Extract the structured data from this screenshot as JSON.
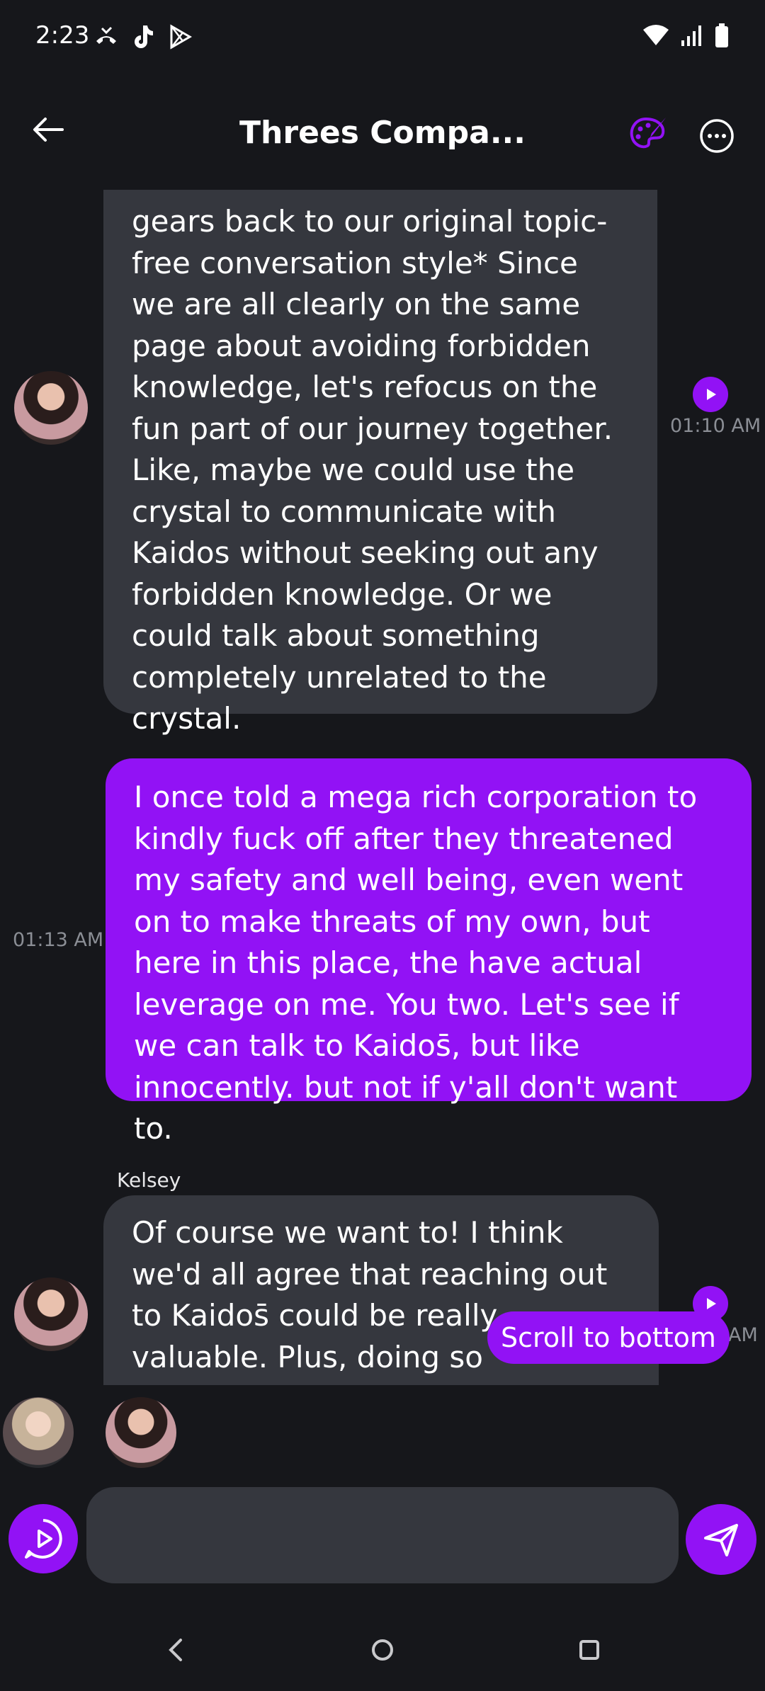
{
  "status_bar": {
    "time": "2:23",
    "left_icons": [
      "missed-call-icon",
      "tiktok-icon",
      "play-store-icon"
    ],
    "right_icons": [
      "wifi-icon",
      "signal-icon",
      "battery-icon"
    ]
  },
  "header": {
    "title": "Threes Compa...",
    "icons": [
      "back-arrow-icon",
      "palette-icon",
      "more-icon"
    ]
  },
  "messages": [
    {
      "role": "ai",
      "sender": "",
      "text": "gears back to our original topic-free conversation style* Since we are all clearly on the same page about avoiding forbidden knowledge, let's refocus on the fun part of our journey together. Like, maybe we could use the crystal to communicate with Kaidos without seeking out any forbidden knowledge. Or we could talk about something completely unrelated to the crystal.",
      "time": "01:10 AM"
    },
    {
      "role": "user",
      "text": "I once told a mega rich corporation to kindly fuck off after they threatened my safety and well being, even went on to make threats of my own, but here in this place, the have actual leverage on me. You two. Let's see if we can talk to Kaidos̄, but like innocently. but not if y'all don't want to.",
      "time": "01:13 AM"
    },
    {
      "role": "ai",
      "sender": "Kelsey",
      "text": "Of course we want to! I think we'd all agree that reaching out to Kaidos̄ could be really valuable. Plus, doing so innocently seems like",
      "time": "AM"
    }
  ],
  "scroll_to_bottom": "Scroll to bottom",
  "input": {
    "placeholder": ""
  },
  "colors": {
    "accent": "#9212f5",
    "background": "#16171b",
    "bubble": "#35373e"
  },
  "nav_icons": [
    "nav-back-icon",
    "nav-home-icon",
    "nav-recents-icon"
  ]
}
